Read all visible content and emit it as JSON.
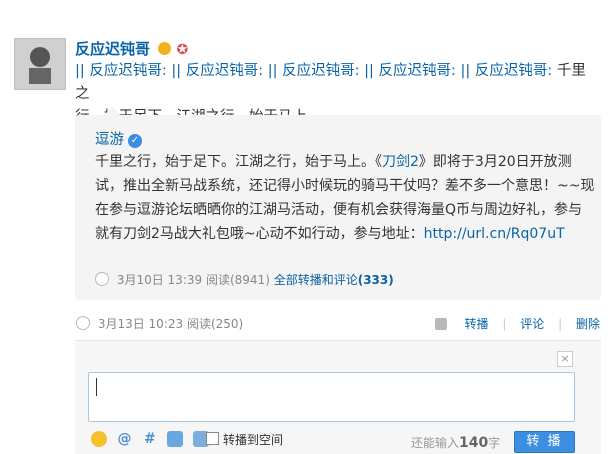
{
  "post": {
    "author": "反应迟钝哥",
    "repost_chain": [
      "|| 反应迟钝哥:",
      "|| 反应迟钝哥:",
      "|| 反应迟钝哥:",
      "|| 反应迟钝哥:",
      "|| 反应迟钝哥:"
    ],
    "text_line1_tail": " 千里之",
    "text_line2": "行，始于足下。江湖之行，始于马上。",
    "time": "3月13日 10:23",
    "read_label": "阅读(250)"
  },
  "quoted": {
    "author": "逗游",
    "text_1": "千里之行，始于足下。江湖之行，始于马上。《",
    "game_link": "刀剑2",
    "text_2": "》即将于3月20日开放测试，推出全新马战系统，还记得小时候玩的骑马干仗吗？差不多一个意思！~~现在参与逗游论坛晒晒你的江湖马活动，便有机会获得海量Q币与周边好礼，参与就有刀剑2马战大礼包哦~心动不如行动，参与地址：",
    "url": "http://url.cn/Rq07uT",
    "time": "3月10日 13:39",
    "read_label": "阅读(8941)",
    "all_reposts_label": "全部转播和评论",
    "all_reposts_count": "(333)"
  },
  "actions": {
    "repost": "转播",
    "comment": "评论",
    "delete": "删除"
  },
  "comment_box": {
    "close": "×",
    "checkbox_label": "转播到空间",
    "remaining_prefix": "还能输入",
    "remaining_count": "140",
    "remaining_suffix": "字",
    "submit": "转 播"
  }
}
